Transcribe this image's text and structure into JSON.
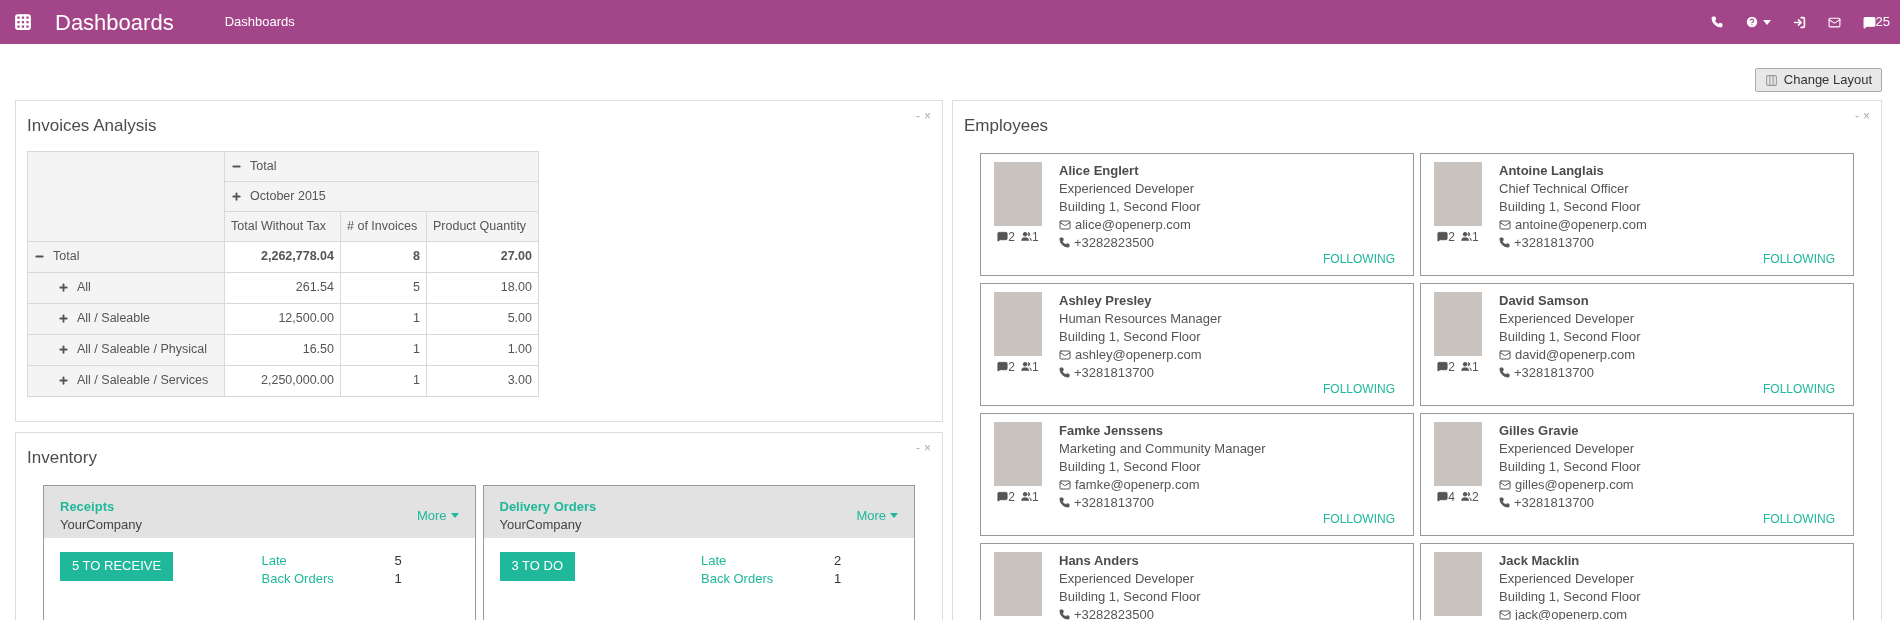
{
  "topbar": {
    "app_title": "Dashboards",
    "breadcrumb": "Dashboards",
    "messages_count": "25"
  },
  "change_layout": {
    "label": "Change Layout"
  },
  "invoices": {
    "title": "Invoices Analysis",
    "controls": [
      "-",
      "×"
    ],
    "col_headers": [
      {
        "label": "Total",
        "expanded": true
      },
      {
        "label": "October 2015",
        "expanded": false
      }
    ],
    "measures": [
      "Total Without Tax",
      "# of Invoices",
      "Product Quantity"
    ],
    "rows": [
      {
        "label": "Total",
        "expanded": true,
        "values": [
          "2,262,778.04",
          "8",
          "27.00"
        ],
        "children": [
          {
            "label": "All",
            "expanded": false,
            "values": [
              "261.54",
              "5",
              "18.00"
            ]
          },
          {
            "label": "All / Saleable",
            "expanded": false,
            "values": [
              "12,500.00",
              "1",
              "5.00"
            ]
          },
          {
            "label": "All / Saleable / Physical",
            "expanded": false,
            "values": [
              "16.50",
              "1",
              "1.00"
            ]
          },
          {
            "label": "All / Saleable / Services",
            "expanded": false,
            "values": [
              "2,250,000.00",
              "1",
              "3.00"
            ]
          }
        ]
      }
    ]
  },
  "inventory": {
    "title": "Inventory",
    "controls": [
      "-",
      "×"
    ],
    "cards": [
      {
        "title": "Receipts",
        "company": "YourCompany",
        "more": "More",
        "action": "5 TO RECEIVE",
        "stats": [
          {
            "label": "Late",
            "value": "5"
          },
          {
            "label": "Back Orders",
            "value": "1"
          }
        ]
      },
      {
        "title": "Delivery Orders",
        "company": "YourCompany",
        "more": "More",
        "action": "3 TO DO",
        "stats": [
          {
            "label": "Late",
            "value": "2"
          },
          {
            "label": "Back Orders",
            "value": "1"
          }
        ]
      }
    ]
  },
  "employees": {
    "title": "Employees",
    "controls": [
      "-",
      "×"
    ],
    "cards": [
      {
        "name": "Alice Englert",
        "job": "Experienced Developer",
        "location": "Building 1, Second Floor",
        "email": "alice@openerp.com",
        "phone": "+3282823500",
        "messages": "2",
        "followers": "1",
        "follow": "FOLLOWING"
      },
      {
        "name": "Antoine Langlais",
        "job": "Chief Technical Officer",
        "location": "Building 1, Second Floor",
        "email": "antoine@openerp.com",
        "phone": "+3281813700",
        "messages": "2",
        "followers": "1",
        "follow": "FOLLOWING"
      },
      {
        "name": "Ashley Presley",
        "job": "Human Resources Manager",
        "location": "Building 1, Second Floor",
        "email": "ashley@openerp.com",
        "phone": "+3281813700",
        "messages": "2",
        "followers": "1",
        "follow": "FOLLOWING"
      },
      {
        "name": "David Samson",
        "job": "Experienced Developer",
        "location": "Building 1, Second Floor",
        "email": "david@openerp.com",
        "phone": "+3281813700",
        "messages": "2",
        "followers": "1",
        "follow": "FOLLOWING"
      },
      {
        "name": "Famke Jenssens",
        "job": "Marketing and Community Manager",
        "location": "Building 1, Second Floor",
        "email": "famke@openerp.com",
        "phone": "+3281813700",
        "messages": "2",
        "followers": "1",
        "follow": "FOLLOWING"
      },
      {
        "name": "Gilles Gravie",
        "job": "Experienced Developer",
        "location": "Building 1, Second Floor",
        "email": "gilles@openerp.com",
        "phone": "+3281813700",
        "messages": "4",
        "followers": "2",
        "follow": "FOLLOWING"
      },
      {
        "name": "Hans Anders",
        "job": "Experienced Developer",
        "location": "Building 1, Second Floor",
        "phone": "+3282823500"
      },
      {
        "name": "Jack Macklin",
        "job": "Experienced Developer",
        "location": "Building 1, Second Floor",
        "email": "jack@openerp.com"
      }
    ]
  }
}
